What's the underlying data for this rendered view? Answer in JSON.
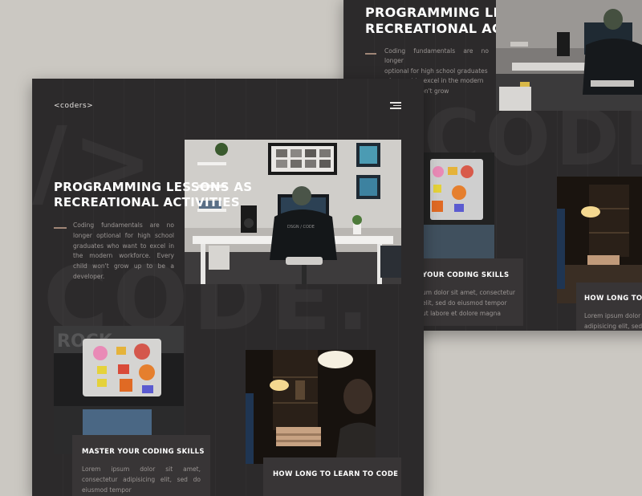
{
  "colors": {
    "background": "#cbc8c2",
    "panel": "#2c2a2b",
    "card": "#383536",
    "accent_dash": "#a08677",
    "title": "#ffffff",
    "body_text": "#9a9593"
  },
  "site": {
    "logo": "<coders>",
    "menu_icon": "hamburger-menu-icon",
    "bg_words": [
      "/>",
      "CODE."
    ]
  },
  "hero": {
    "title_line1": "PROGRAMMING LESSONS AS",
    "title_line2": "RECREATIONAL ACTIVITIES",
    "paragraph": "Coding fundamentals are no longer optional for high school graduates who want to excel in the modern workforce. Every child won't grow up to be a developer.",
    "back_paragraph_lines": [
      "Coding fundamentals are no longer",
      "optional for high school graduates",
      "who want to excel in the modern",
      "very child won't grow",
      "loper."
    ]
  },
  "cards": [
    {
      "title": "MASTER YOUR CODING SKILLS",
      "back_title": "YOUR CODING SKILLS",
      "text": "Lorem ipsum dolor sit amet, consectetur adipisicing elit, sed do eiusmod tempor",
      "back_text_lines": [
        "um dolor sit amet, consectetur",
        "elit, sed do eiusmod tempor",
        "ut labore et dolore magna"
      ]
    },
    {
      "title": "HOW LONG TO LEARN TO CODE",
      "back_title": "HOW LONG TO LE",
      "back_text_lines": [
        "Lorem ipsum dolor sit",
        "adipisicing elit, sed"
      ]
    }
  ]
}
